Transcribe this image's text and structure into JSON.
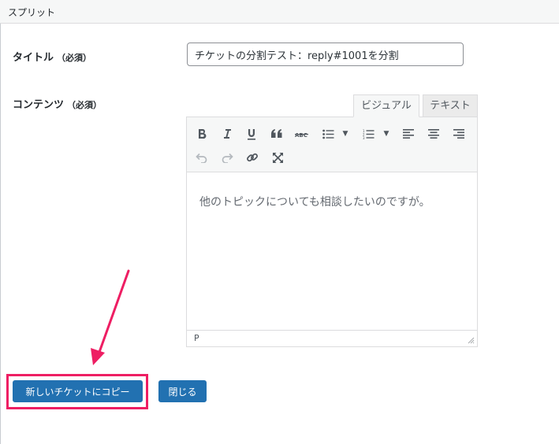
{
  "header": {
    "title": "スプリット"
  },
  "form": {
    "title_label": "タイトル",
    "content_label": "コンテンツ",
    "required_mark": "（必須）",
    "title_value": "チケットの分割テスト：reply#1001を分割"
  },
  "editor": {
    "tabs": [
      {
        "label": "ビジュアル",
        "active": true
      },
      {
        "label": "テキスト",
        "active": false
      }
    ],
    "toolbar": [
      "bold-icon",
      "italic-icon",
      "underline-icon",
      "blockquote-icon",
      "strikethrough-icon",
      "bullet-list-icon",
      "numbered-list-icon",
      "align-left-icon",
      "align-center-icon",
      "align-right-icon",
      "undo-icon",
      "redo-icon",
      "link-icon",
      "fullscreen-icon"
    ],
    "content": "他のトピックについても相談したいのですが。",
    "path": "P"
  },
  "actions": {
    "copy_label": "新しいチケットにコピー",
    "close_label": "閉じる"
  },
  "colors": {
    "accent": "#2271b1",
    "highlight": "#ee1e63"
  }
}
